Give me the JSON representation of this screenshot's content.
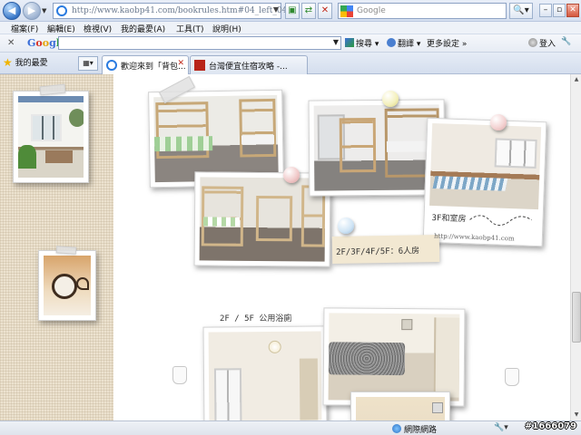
{
  "address_bar": {
    "url": "http://www.kaobp41.com/bookrules.htm#04_left_04"
  },
  "search": {
    "placeholder": "Google"
  },
  "menu": {
    "items": [
      "檔案(F)",
      "編輯(E)",
      "檢視(V)",
      "我的最愛(A)",
      "工具(T)",
      "說明(H)"
    ]
  },
  "google_toolbar": {
    "logo": "Google",
    "search_label": "搜尋",
    "translate_label": "翻譯",
    "more_label": "更多設定",
    "signin_label": "登入"
  },
  "favorites_label": "我的最愛",
  "tabs": [
    {
      "label": "歡迎來到「背包...",
      "active": true
    },
    {
      "label": "台灣便宜住宿攻略 -...",
      "active": false
    }
  ],
  "page": {
    "caption_3f": "3F和室房",
    "note_rooms": "2F/3F/4F/5F：6人房",
    "url_caption": "http://www.kaobp41.com",
    "bath_caption": "2F / 5F 公用浴廁"
  },
  "status": {
    "zone_label": "網際網路",
    "zoom": ""
  },
  "watermark": "#1666079",
  "colors": {
    "chrome": "#d6e0f0",
    "linen": "#ece2cf",
    "note": "#f2e8d2"
  }
}
